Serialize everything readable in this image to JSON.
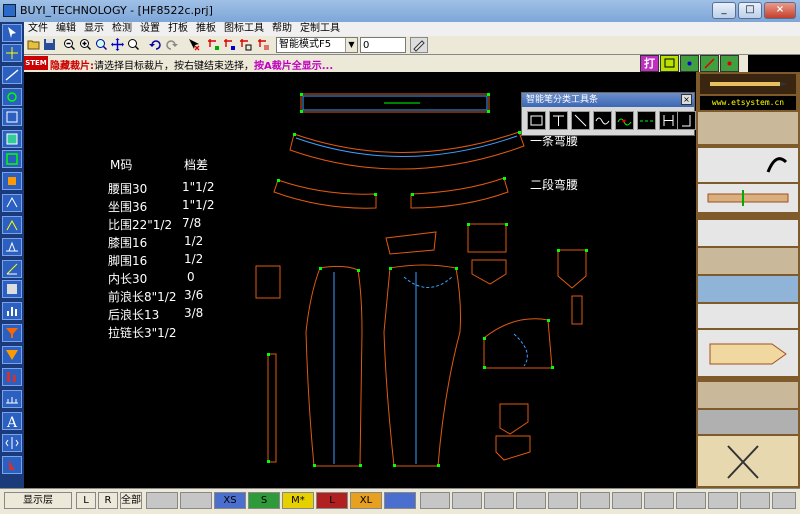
{
  "window": {
    "title": "BUYI_TECHNOLOGY - [HF8522c.prj]",
    "minimize": "_",
    "maximize": "□",
    "close": "×"
  },
  "menu": [
    "文件",
    "编辑",
    "显示",
    "检测",
    "设置",
    "打板",
    "推板",
    "图标工具",
    "帮助",
    "定制工具"
  ],
  "toolbar": {
    "mode_value": "智能模式F5",
    "input_value": "0"
  },
  "prompt": {
    "badge": "STEM",
    "prefix": "隐藏裁片:",
    "message": "请选择目标裁片，按右键结束选择，",
    "highlight": "按A裁片全显示..."
  },
  "print_group": {
    "print_label": "打"
  },
  "palette": {
    "title": "智能笔分类工具条",
    "close": "×"
  },
  "size_table": {
    "heading": [
      "M码",
      "档差"
    ],
    "rows": [
      [
        "腰围30",
        "1\"1/2"
      ],
      [
        "坐围36",
        "1\"1/2"
      ],
      [
        "比围22\"1/2",
        "7/8"
      ],
      [
        "膝围16",
        "1/2"
      ],
      [
        "脚围16",
        "1/2"
      ],
      [
        "内长30",
        "0"
      ],
      [
        "前浪长8\"1/2",
        "3/6"
      ],
      [
        "后浪长13",
        "3/8"
      ],
      [
        "拉链长3\"1/2",
        ""
      ]
    ]
  },
  "notes": {
    "one_piece": "一条弯腰",
    "two_piece": "二段弯腰"
  },
  "right_panel": {
    "website": "www.etsystem.cn"
  },
  "status": {
    "layer": "显示层",
    "left": "L",
    "right": "R",
    "all": "全部",
    "sizes": [
      {
        "label": "",
        "color": "#c6c6c6"
      },
      {
        "label": "",
        "color": "#c6c6c6"
      },
      {
        "label": "XS",
        "color": "#4a6fcf"
      },
      {
        "label": "S",
        "color": "#2e9a3a"
      },
      {
        "label": "M*",
        "color": "#e6d000"
      },
      {
        "label": "L",
        "color": "#b02020"
      },
      {
        "label": "XL",
        "color": "#e8a020"
      },
      {
        "label": "",
        "color": "#4a6fcf"
      }
    ]
  }
}
